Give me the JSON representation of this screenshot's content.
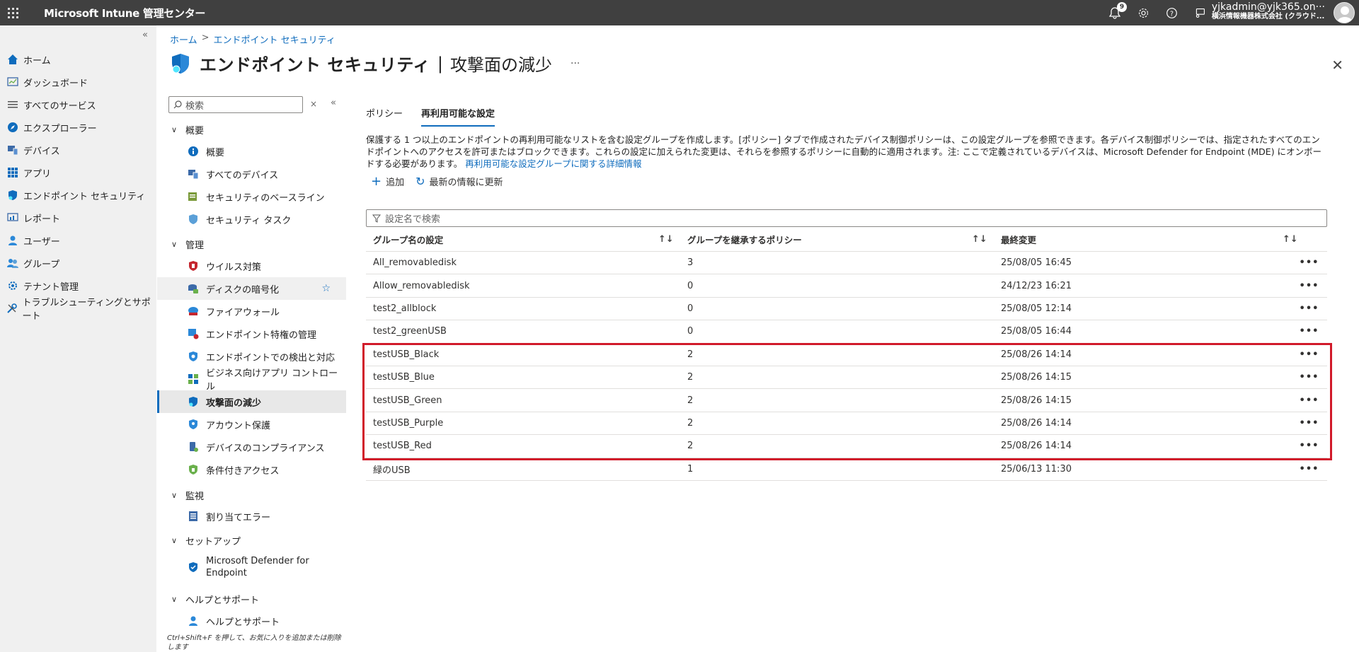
{
  "topbar": {
    "app_title": "Microsoft Intune 管理センター",
    "notification_count": "9",
    "account_name": "yjkadmin@yjk365.on···",
    "account_org": "横浜情報機器株式会社 (クラウド..."
  },
  "leftnav": {
    "collapse": "«",
    "items": [
      {
        "label": "ホーム",
        "icon": "home-icon"
      },
      {
        "label": "ダッシュボード",
        "icon": "dashboard-icon"
      },
      {
        "label": "すべてのサービス",
        "icon": "list-icon"
      },
      {
        "label": "エクスプローラー",
        "icon": "explorer-icon"
      },
      {
        "label": "デバイス",
        "icon": "device-icon"
      },
      {
        "label": "アプリ",
        "icon": "apps-icon"
      },
      {
        "label": "エンドポイント セキュリティ",
        "icon": "endpoint-security-icon"
      },
      {
        "label": "レポート",
        "icon": "report-icon"
      },
      {
        "label": "ユーザー",
        "icon": "user-icon"
      },
      {
        "label": "グループ",
        "icon": "group-icon"
      },
      {
        "label": "テナント管理",
        "icon": "tenant-icon"
      },
      {
        "label": "トラブルシューティングとサポート",
        "icon": "troubleshoot-icon"
      }
    ]
  },
  "breadcrumb": {
    "home": "ホーム",
    "sep": ">",
    "current": "エンドポイント セキュリティ"
  },
  "header": {
    "title": "エンドポイント セキュリティ",
    "sep": "|",
    "subtitle": "攻撃面の減少",
    "more": "···",
    "close": "✕"
  },
  "subnav": {
    "search_placeholder": "検索",
    "clear": "×",
    "collapse": "«",
    "sections": {
      "overview": "概要",
      "manage": "管理",
      "monitor": "監視",
      "setup": "セットアップ",
      "help": "ヘルプとサポート"
    },
    "items": {
      "overview": "概要",
      "all_devices": "すべてのデバイス",
      "baselines": "セキュリティのベースライン",
      "tasks": "セキュリティ タスク",
      "antivirus": "ウイルス対策",
      "disk_encryption": "ディスクの暗号化",
      "firewall": "ファイアウォール",
      "epm": "エンドポイント特権の管理",
      "edr": "エンドポイントでの検出と対応",
      "app_control": "ビジネス向けアプリ コントロール",
      "asr": "攻撃面の減少",
      "account_protection": "アカウント保護",
      "compliance": "デバイスのコンプライアンス",
      "conditional_access": "条件付きアクセス",
      "assignment_errors": "割り当てエラー",
      "defender_line1": "Microsoft Defender for",
      "defender_line2": "Endpoint",
      "help_support": "ヘルプとサポート"
    },
    "star": "☆",
    "hint": "Ctrl+Shift+F を押して、お気に入りを追加または削除します"
  },
  "tabs": [
    {
      "label": "ポリシー"
    },
    {
      "label": "再利用可能な設定"
    }
  ],
  "description": {
    "text": "保護する 1 つ以上のエンドポイントの再利用可能なリストを含む設定グループを作成します。[ポリシー] タブで作成されたデバイス制御ポリシーは、この設定グループを参照できます。各デバイス制御ポリシーでは、指定されたすべてのエンドポイントへのアクセスを許可またはブロックできます。これらの設定に加えられた変更は、それらを参照するポリシーに自動的に適用されます。注: ここで定義されているデバイスは、Microsoft Defender for Endpoint (MDE) にオンボードする必要があります。",
    "link": "再利用可能な設定グループに関する詳細情報"
  },
  "commands": {
    "add": "追加",
    "refresh": "最新の情報に更新"
  },
  "filter": {
    "placeholder": "設定名で検索"
  },
  "table": {
    "headers": [
      "グループ名の設定",
      "グループを継承するポリシー",
      "最終変更"
    ],
    "sort_glyph": "↑↓",
    "more_glyph": "•••",
    "rows": [
      {
        "name": "All_removabledisk",
        "policies": "3",
        "modified": "25/08/05 16:45"
      },
      {
        "name": "Allow_removabledisk",
        "policies": "0",
        "modified": "24/12/23 16:21"
      },
      {
        "name": "test2_allblock",
        "policies": "0",
        "modified": "25/08/05 12:14"
      },
      {
        "name": "test2_greenUSB",
        "policies": "0",
        "modified": "25/08/05 16:44"
      },
      {
        "name": "testUSB_Black",
        "policies": "2",
        "modified": "25/08/26 14:14"
      },
      {
        "name": "testUSB_Blue",
        "policies": "2",
        "modified": "25/08/26 14:15"
      },
      {
        "name": "testUSB_Green",
        "policies": "2",
        "modified": "25/08/26 14:15"
      },
      {
        "name": "testUSB_Purple",
        "policies": "2",
        "modified": "25/08/26 14:14"
      },
      {
        "name": "testUSB_Red",
        "policies": "2",
        "modified": "25/08/26 14:14"
      },
      {
        "name": "緑のUSB",
        "policies": "1",
        "modified": "25/06/13 11:30"
      }
    ]
  },
  "colors": {
    "accent": "#0f6cbd",
    "highlight": "#d11a2a",
    "topbar": "#404040"
  }
}
